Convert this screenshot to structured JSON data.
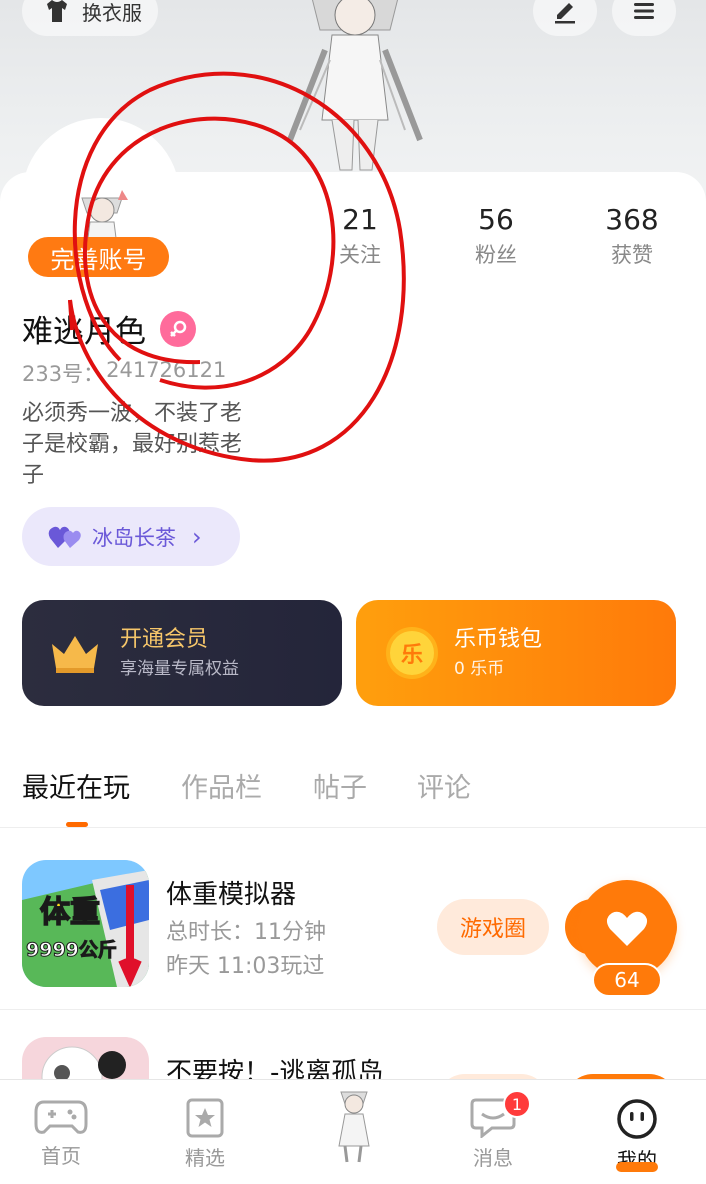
{
  "header": {
    "outfit_label": "换衣服",
    "edit_icon": "edit-icon",
    "menu_icon": "menu-icon"
  },
  "profile": {
    "complete_badge": "完善账号",
    "stats": [
      {
        "num": "21",
        "label": "关注"
      },
      {
        "num": "56",
        "label": "粉丝"
      },
      {
        "num": "368",
        "label": "获赞"
      }
    ],
    "name": "难逃月色",
    "gender": "female",
    "uid_label": "233号：",
    "uid_value": "241726121",
    "bio": "必须秀一波，不装了老子是校霸，最好别惹老子",
    "guild": "冰岛长茶"
  },
  "promo": {
    "vip_title": "开通会员",
    "vip_sub": "享海量专属权益",
    "wallet_title": "乐币钱包",
    "wallet_sub": "0 乐币",
    "wallet_coin_glyph": "乐"
  },
  "tabs": [
    "最近在玩",
    "作品栏",
    "帖子",
    "评论"
  ],
  "games": [
    {
      "title": "体重模拟器",
      "playtime": "总时长：11分钟",
      "last_played": "昨天 11:03玩过",
      "icon_text_1": "体重",
      "icon_text_2": "9999公斤",
      "circle_label": "游戏圈"
    },
    {
      "title": "不要按！-逃离孤岛"
    }
  ],
  "like": {
    "count": "64"
  },
  "nav": [
    {
      "label": "首页",
      "icon": "gamepad-icon"
    },
    {
      "label": "精选",
      "icon": "star-card-icon"
    },
    {
      "label": "",
      "icon": "character-avatar-icon"
    },
    {
      "label": "消息",
      "icon": "chat-bubble-icon",
      "badge": "1"
    },
    {
      "label": "我的",
      "icon": "face-icon"
    }
  ],
  "colors": {
    "accent": "#ff7a0a",
    "scribble": "#e01010",
    "guild_text": "#6a58d8"
  }
}
